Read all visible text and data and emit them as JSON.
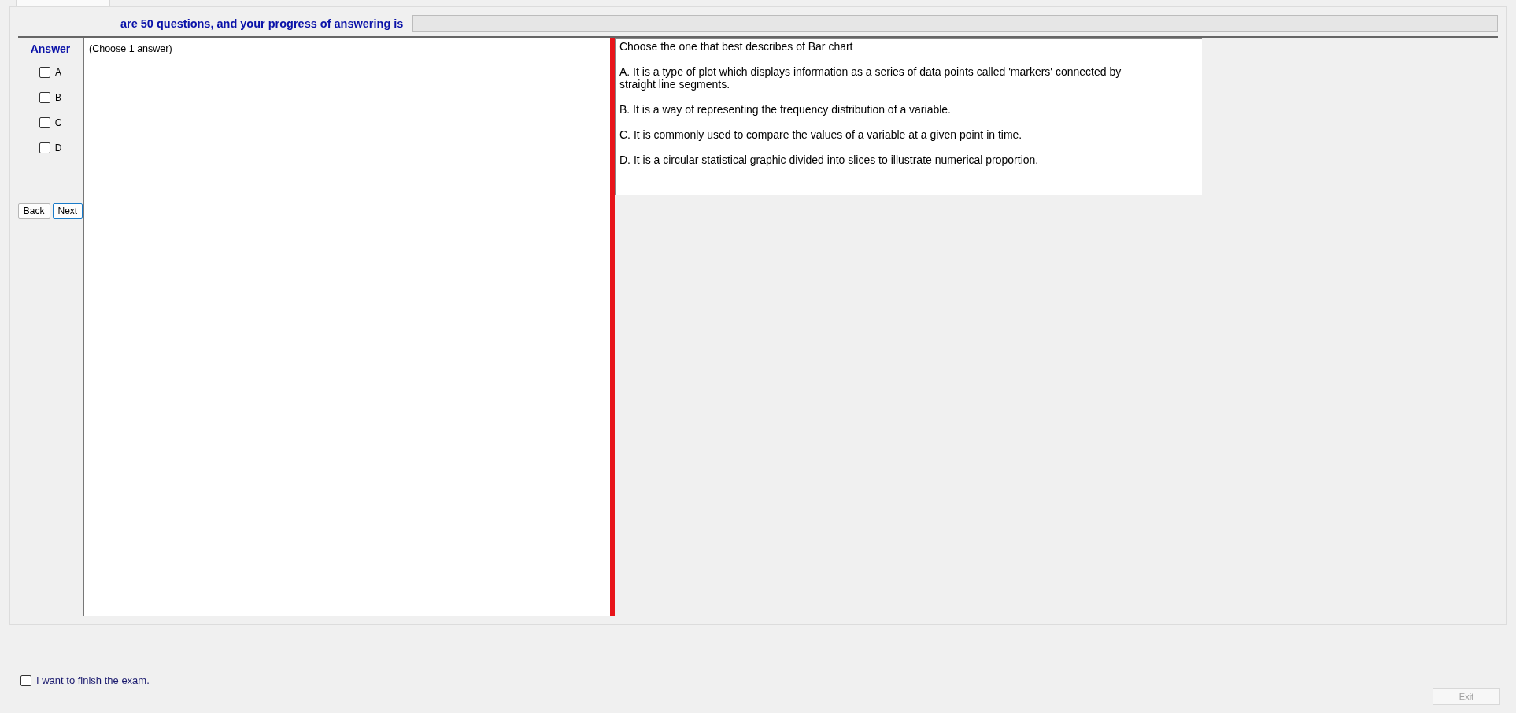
{
  "progress": {
    "label": "are 50 questions, and your progress of answering is",
    "level": 0
  },
  "answer_panel": {
    "title": "Answer",
    "options": [
      {
        "label": "A",
        "checked": false
      },
      {
        "label": "B",
        "checked": false
      },
      {
        "label": "C",
        "checked": false
      },
      {
        "label": "D",
        "checked": false
      }
    ],
    "buttons": [
      {
        "label": "Back",
        "focused": false
      },
      {
        "label": "Next",
        "focused": true
      }
    ]
  },
  "instruction": "(Choose 1 answer)",
  "question": {
    "text": "Choose the one that best describes of Bar chart",
    "choices": [
      "A.  It is a type of plot which displays information as a series of data points called 'markers' connected by straight line segments.",
      "B.  It is a way of representing the frequency distribution of a variable.",
      "C.  It is commonly used to compare the values of a variable at a given point in time.",
      "D.  It is a circular statistical graphic divided into slices to illustrate numerical proportion."
    ]
  },
  "finish": {
    "label": "I want to finish the exam.",
    "checked": false
  },
  "exit_button": {
    "label": "Exit",
    "disabled": true
  }
}
